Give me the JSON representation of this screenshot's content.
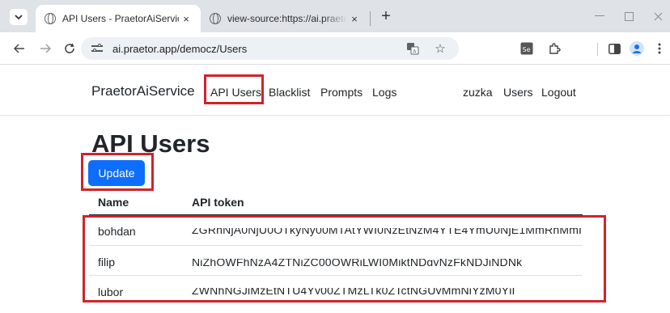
{
  "browser": {
    "tabs": [
      {
        "title": "API Users - PraetorAiService",
        "close": "×"
      },
      {
        "title": "view-source:https://ai.praetor.app",
        "close": "×"
      }
    ],
    "new_tab": "+",
    "url": "ai.praetor.app/democz/Users"
  },
  "navbar": {
    "brand": "PraetorAiService",
    "links": [
      "API Users",
      "Blacklist",
      "Prompts",
      "Logs"
    ],
    "user": "zuzka",
    "users_link": "Users",
    "logout": "Logout"
  },
  "page": {
    "title": "API Users",
    "update_button": "Update",
    "columns": [
      "Name",
      "API token"
    ],
    "rows": [
      {
        "name": "bohdan",
        "token": "ZGRhNjA0NjU0OTkyNy00MTAtYWI0NzEtNzM4YTE4YmU0NjE1MmRhMmI"
      },
      {
        "name": "filip",
        "token": "NjZhOWFhNzA4ZTNiZC00OWRiLWI0MjktNDgyNzFkNDJjNDNk"
      },
      {
        "name": "lubor",
        "token": "ZWNhNGJjMzEtNTU4Yy00ZTMzLTk0ZTctNGUyMmNjYzM0YjI"
      }
    ]
  },
  "colors": {
    "highlight": "#d0232a",
    "primary": "#0d6efd"
  }
}
